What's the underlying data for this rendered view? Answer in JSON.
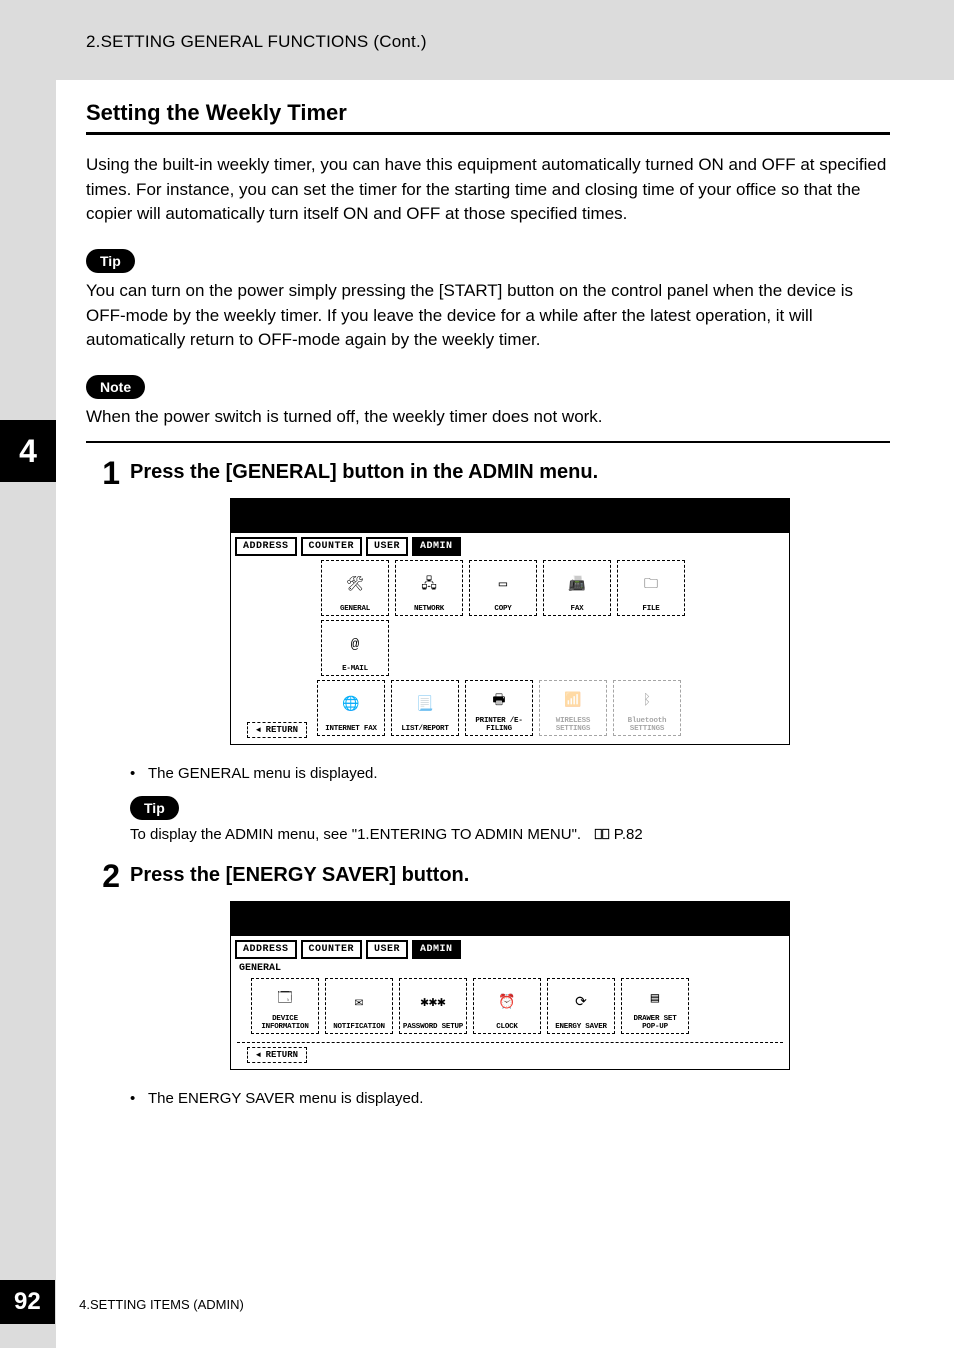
{
  "header": {
    "breadcrumb": "2.SETTING GENERAL FUNCTIONS (Cont.)"
  },
  "chapter_tab": "4",
  "section": {
    "title": "Setting the Weekly Timer",
    "intro": "Using the built-in weekly timer, you can have this equipment automatically turned ON and OFF at specified times.  For instance, you can set the timer for the starting time and closing time of your office so that the copier will automatically turn itself ON and OFF at those specified times."
  },
  "tip1": {
    "label": "Tip",
    "text": "You can turn on the power simply pressing the [START] button on the control panel when the device is OFF-mode by the weekly timer.  If you leave the device for a while after the latest operation, it will automatically return to OFF-mode again by the weekly timer."
  },
  "note": {
    "label": "Note",
    "text": "When the power switch is turned off, the weekly timer does not work."
  },
  "step1": {
    "number": "1",
    "heading": "Press the [GENERAL] button in the ADMIN menu.",
    "bullet": "The GENERAL menu is displayed.",
    "tip_label": "Tip",
    "tip_text": "To display the ADMIN menu, see \"1.ENTERING TO ADMIN MENU\".",
    "page_ref": "P.82",
    "lcd": {
      "tabs": [
        "ADDRESS",
        "COUNTER",
        "USER",
        "ADMIN"
      ],
      "active_tab": "ADMIN",
      "row1": [
        {
          "label": "GENERAL",
          "icon": "general"
        },
        {
          "label": "NETWORK",
          "icon": "network"
        },
        {
          "label": "COPY",
          "icon": "copy"
        },
        {
          "label": "FAX",
          "icon": "fax"
        },
        {
          "label": "FILE",
          "icon": "file"
        },
        {
          "label": "E-MAIL",
          "icon": "email"
        }
      ],
      "row2": [
        {
          "label": "INTERNET FAX",
          "icon": "ifax"
        },
        {
          "label": "LIST/REPORT",
          "icon": "list"
        },
        {
          "label": "PRINTER /E-FILING",
          "icon": "printer"
        },
        {
          "label": "WIRELESS SETTINGS",
          "icon": "wireless",
          "dim": true
        },
        {
          "label": "Bluetooth SETTINGS",
          "icon": "bluetooth",
          "dim": true
        }
      ],
      "return": "RETURN"
    }
  },
  "step2": {
    "number": "2",
    "heading": "Press the [ENERGY SAVER] button.",
    "bullet": "The ENERGY SAVER menu is displayed.",
    "lcd": {
      "tabs": [
        "ADDRESS",
        "COUNTER",
        "USER",
        "ADMIN"
      ],
      "active_tab": "ADMIN",
      "breadcrumb": "GENERAL",
      "row1": [
        {
          "label": "DEVICE INFORMATION",
          "icon": "device"
        },
        {
          "label": "NOTIFICATION",
          "icon": "notify"
        },
        {
          "label": "PASSWORD SETUP",
          "icon": "password"
        },
        {
          "label": "CLOCK",
          "icon": "clock"
        },
        {
          "label": "ENERGY SAVER",
          "icon": "energy"
        },
        {
          "label": "DRAWER SET POP-UP",
          "icon": "drawer"
        }
      ],
      "return": "RETURN"
    }
  },
  "footer": {
    "page": "92",
    "text": "4.SETTING ITEMS (ADMIN)"
  }
}
